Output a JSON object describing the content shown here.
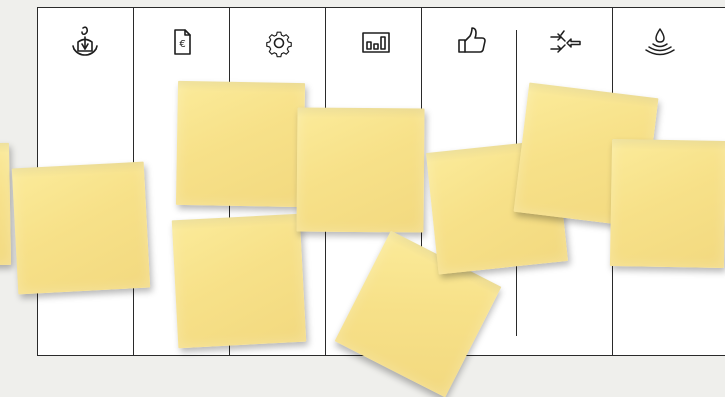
{
  "board": {
    "columns": [
      {
        "icon": "person-hands-icon"
      },
      {
        "icon": "euro-document-icon"
      },
      {
        "icon": "gear-icon"
      },
      {
        "icon": "bar-chart-icon"
      },
      {
        "icon": "thumbs-up-icon"
      },
      {
        "icon": "exchange-arrows-icon"
      },
      {
        "icon": "water-drop-icon"
      }
    ],
    "sticky_notes": [
      {
        "text": ""
      },
      {
        "text": ""
      },
      {
        "text": ""
      },
      {
        "text": ""
      },
      {
        "text": ""
      },
      {
        "text": ""
      },
      {
        "text": ""
      },
      {
        "text": ""
      },
      {
        "text": ""
      },
      {
        "text": ""
      }
    ]
  },
  "colors": {
    "background": "#efefec",
    "board": "#ffffff",
    "lines": "#2a2a2a",
    "sticky_note": "#f7e189"
  }
}
